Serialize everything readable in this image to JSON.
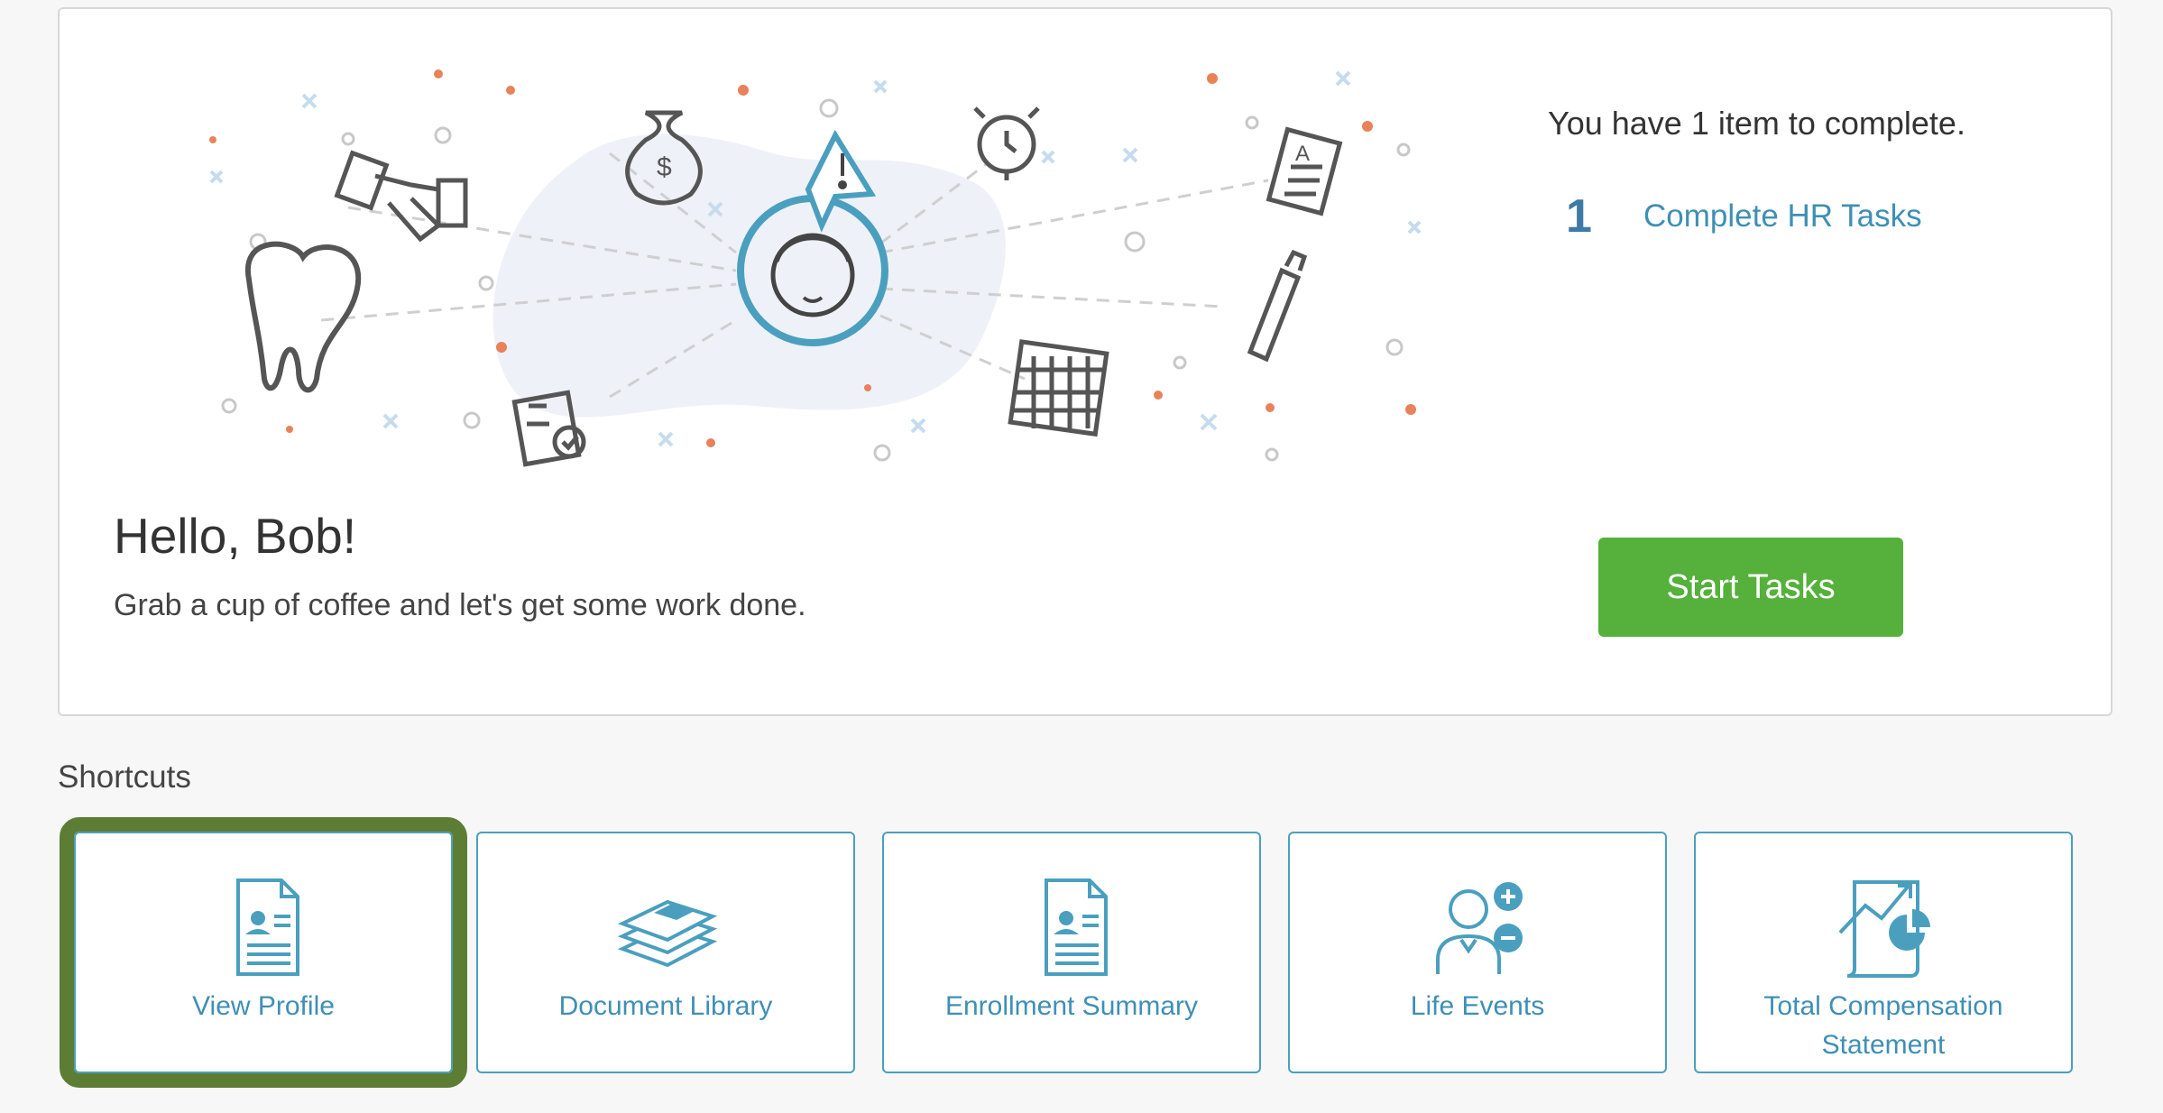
{
  "hero": {
    "greeting": "Hello, Bob!",
    "subtitle": "Grab a cup of coffee and let's get some work done.",
    "items_summary": "You have 1 item to complete.",
    "task_count": "1",
    "task_link": "Complete HR Tasks",
    "start_button": "Start Tasks",
    "start_button_color": "#55b13b",
    "accent_color": "#4a9fbf"
  },
  "shortcuts": {
    "title": "Shortcuts",
    "items": [
      {
        "label": "View Profile",
        "icon": "profile-document-icon",
        "selected": true
      },
      {
        "label": "Document Library",
        "icon": "books-stack-icon"
      },
      {
        "label": "Enrollment Summary",
        "icon": "enrollment-document-icon"
      },
      {
        "label": "Life Events",
        "icon": "person-plus-minus-icon"
      },
      {
        "label": "Total Compensation Statement",
        "icon": "compensation-chart-icon"
      }
    ],
    "selection_color": "#5d7d35"
  }
}
